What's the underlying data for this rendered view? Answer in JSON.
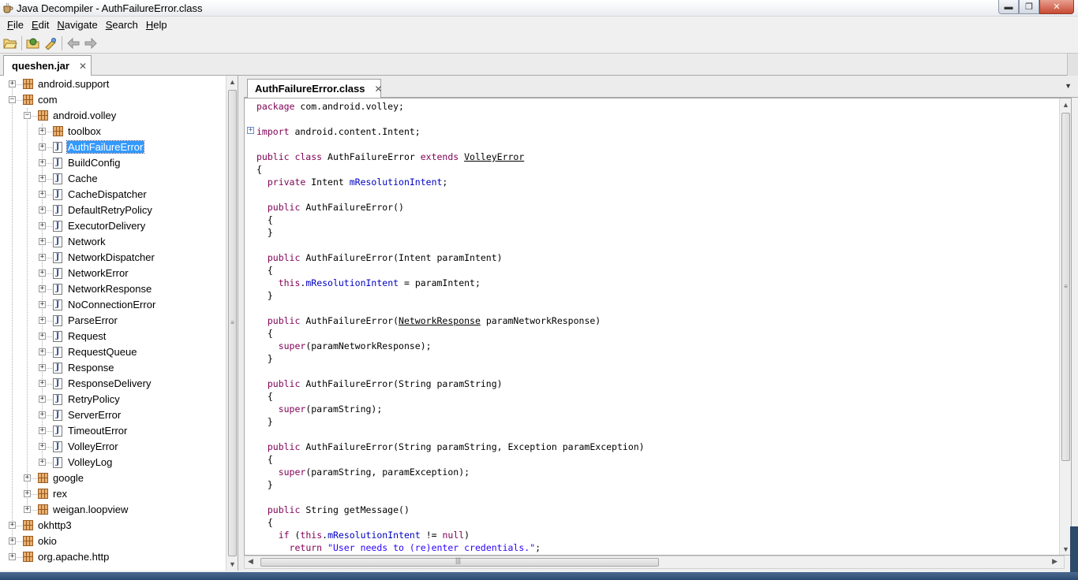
{
  "window": {
    "title": "Java Decompiler - AuthFailureError.class",
    "minimize": "▬",
    "maximize": "❐",
    "close": "✕"
  },
  "menu": [
    {
      "label": "File",
      "mnemonic": "F",
      "rest": "ile"
    },
    {
      "label": "Edit",
      "mnemonic": "E",
      "rest": "dit"
    },
    {
      "label": "Navigate",
      "mnemonic": "N",
      "rest": "avigate"
    },
    {
      "label": "Search",
      "mnemonic": "S",
      "rest": "earch"
    },
    {
      "label": "Help",
      "mnemonic": "H",
      "rest": "elp"
    }
  ],
  "toolbar": {
    "icons": [
      "open-folder-icon",
      "open-type-icon",
      "open-type-hierarchy-icon",
      "back-arrow-icon",
      "forward-arrow-icon"
    ]
  },
  "jar_tab": {
    "label": "queshen.jar",
    "close": "✕"
  },
  "tree": [
    {
      "label": "android.support",
      "type": "package",
      "level": 0,
      "expanded": false
    },
    {
      "label": "com",
      "type": "package",
      "level": 0,
      "expanded": true
    },
    {
      "label": "android.volley",
      "type": "package",
      "level": 1,
      "expanded": true
    },
    {
      "label": "toolbox",
      "type": "package",
      "level": 2,
      "expanded": false
    },
    {
      "label": "AuthFailureError",
      "type": "class",
      "level": 2,
      "selected": true
    },
    {
      "label": "BuildConfig",
      "type": "class",
      "level": 2
    },
    {
      "label": "Cache",
      "type": "class",
      "level": 2
    },
    {
      "label": "CacheDispatcher",
      "type": "class",
      "level": 2
    },
    {
      "label": "DefaultRetryPolicy",
      "type": "class",
      "level": 2
    },
    {
      "label": "ExecutorDelivery",
      "type": "class",
      "level": 2
    },
    {
      "label": "Network",
      "type": "class",
      "level": 2
    },
    {
      "label": "NetworkDispatcher",
      "type": "class",
      "level": 2
    },
    {
      "label": "NetworkError",
      "type": "class",
      "level": 2
    },
    {
      "label": "NetworkResponse",
      "type": "class",
      "level": 2
    },
    {
      "label": "NoConnectionError",
      "type": "class",
      "level": 2
    },
    {
      "label": "ParseError",
      "type": "class",
      "level": 2
    },
    {
      "label": "Request",
      "type": "class",
      "level": 2
    },
    {
      "label": "RequestQueue",
      "type": "class",
      "level": 2
    },
    {
      "label": "Response",
      "type": "class",
      "level": 2
    },
    {
      "label": "ResponseDelivery",
      "type": "class",
      "level": 2
    },
    {
      "label": "RetryPolicy",
      "type": "class",
      "level": 2
    },
    {
      "label": "ServerError",
      "type": "class",
      "level": 2
    },
    {
      "label": "TimeoutError",
      "type": "class",
      "level": 2
    },
    {
      "label": "VolleyError",
      "type": "class",
      "level": 2
    },
    {
      "label": "VolleyLog",
      "type": "class",
      "level": 2
    },
    {
      "label": "google",
      "type": "package",
      "level": 1,
      "expanded": false
    },
    {
      "label": "rex",
      "type": "package",
      "level": 1,
      "expanded": false
    },
    {
      "label": "weigan.loopview",
      "type": "package",
      "level": 1,
      "expanded": false
    },
    {
      "label": "okhttp3",
      "type": "package",
      "level": 0,
      "expanded": false
    },
    {
      "label": "okio",
      "type": "package",
      "level": 0,
      "expanded": false
    },
    {
      "label": "org.apache.http",
      "type": "package",
      "level": 0,
      "expanded": false
    }
  ],
  "editor_tab": {
    "label": "AuthFailureError.class",
    "close": "✕"
  },
  "code": [
    [
      [
        "kw",
        "package"
      ],
      [
        "t",
        " com.android.volley;"
      ]
    ],
    [],
    [
      [
        "kw",
        "import"
      ],
      [
        "t",
        " android.content.Intent;"
      ]
    ],
    [],
    [
      [
        "kw",
        "public class"
      ],
      [
        "t",
        " AuthFailureError "
      ],
      [
        "kw",
        "extends"
      ],
      [
        "t",
        " "
      ],
      [
        "ul",
        "VolleyError"
      ]
    ],
    [
      [
        "t",
        "{"
      ]
    ],
    [
      [
        "t",
        "  "
      ],
      [
        "kw",
        "private"
      ],
      [
        "t",
        " Intent "
      ],
      [
        "fld",
        "mResolutionIntent"
      ],
      [
        "t",
        ";"
      ]
    ],
    [],
    [
      [
        "t",
        "  "
      ],
      [
        "kw",
        "public"
      ],
      [
        "t",
        " AuthFailureError()"
      ]
    ],
    [
      [
        "t",
        "  {"
      ]
    ],
    [
      [
        "t",
        "  }"
      ]
    ],
    [],
    [
      [
        "t",
        "  "
      ],
      [
        "kw",
        "public"
      ],
      [
        "t",
        " AuthFailureError(Intent paramIntent)"
      ]
    ],
    [
      [
        "t",
        "  {"
      ]
    ],
    [
      [
        "t",
        "    "
      ],
      [
        "kw",
        "this"
      ],
      [
        "t",
        "."
      ],
      [
        "fld",
        "mResolutionIntent"
      ],
      [
        "t",
        " = paramIntent;"
      ]
    ],
    [
      [
        "t",
        "  }"
      ]
    ],
    [],
    [
      [
        "t",
        "  "
      ],
      [
        "kw",
        "public"
      ],
      [
        "t",
        " AuthFailureError("
      ],
      [
        "ul",
        "NetworkResponse"
      ],
      [
        "t",
        " paramNetworkResponse)"
      ]
    ],
    [
      [
        "t",
        "  {"
      ]
    ],
    [
      [
        "t",
        "    "
      ],
      [
        "kw",
        "super"
      ],
      [
        "t",
        "(paramNetworkResponse);"
      ]
    ],
    [
      [
        "t",
        "  }"
      ]
    ],
    [],
    [
      [
        "t",
        "  "
      ],
      [
        "kw",
        "public"
      ],
      [
        "t",
        " AuthFailureError(String paramString)"
      ]
    ],
    [
      [
        "t",
        "  {"
      ]
    ],
    [
      [
        "t",
        "    "
      ],
      [
        "kw",
        "super"
      ],
      [
        "t",
        "(paramString);"
      ]
    ],
    [
      [
        "t",
        "  }"
      ]
    ],
    [],
    [
      [
        "t",
        "  "
      ],
      [
        "kw",
        "public"
      ],
      [
        "t",
        " AuthFailureError(String paramString, Exception paramException)"
      ]
    ],
    [
      [
        "t",
        "  {"
      ]
    ],
    [
      [
        "t",
        "    "
      ],
      [
        "kw",
        "super"
      ],
      [
        "t",
        "(paramString, paramException);"
      ]
    ],
    [
      [
        "t",
        "  }"
      ]
    ],
    [],
    [
      [
        "t",
        "  "
      ],
      [
        "kw",
        "public"
      ],
      [
        "t",
        " String getMessage()"
      ]
    ],
    [
      [
        "t",
        "  {"
      ]
    ],
    [
      [
        "t",
        "    "
      ],
      [
        "kw",
        "if"
      ],
      [
        "t",
        " ("
      ],
      [
        "kw",
        "this"
      ],
      [
        "t",
        "."
      ],
      [
        "fld",
        "mResolutionIntent"
      ],
      [
        "t",
        " != "
      ],
      [
        "kw",
        "null"
      ],
      [
        "t",
        ")"
      ]
    ],
    [
      [
        "t",
        "      "
      ],
      [
        "kw",
        "return"
      ],
      [
        "t",
        " "
      ],
      [
        "str",
        "\"User needs to (re)enter credentials.\""
      ],
      [
        "t",
        ";"
      ]
    ]
  ],
  "colors": {
    "keyword": "#7f0055",
    "field": "#0000c0",
    "string": "#2a00ff",
    "selection": "#3399ff"
  }
}
